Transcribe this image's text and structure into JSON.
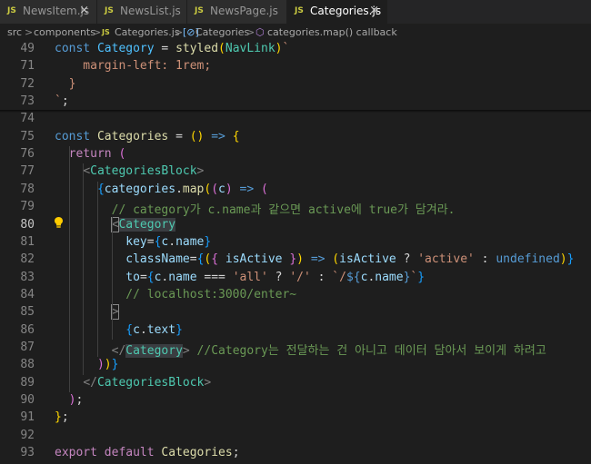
{
  "tabs": [
    {
      "icon": "JS",
      "label": "NewsItem.js",
      "close": "×"
    },
    {
      "icon": "JS",
      "label": "NewsList.js"
    },
    {
      "icon": "JS",
      "label": "NewsPage.js"
    },
    {
      "icon": "JS",
      "label": "Categories.js",
      "close": "×"
    }
  ],
  "breadcrumb": {
    "items": [
      "src",
      "components",
      "Categories.js",
      "Categories",
      "categories.map() callback"
    ],
    "separator": ">",
    "file_icon": "JS",
    "symbol_icon": "[⊘]"
  },
  "colors": {
    "keyword": "#569cd6",
    "control": "#c586c0",
    "function": "#dcdcaa",
    "variable": "#9cdcfe",
    "constant": "#4fc1ff",
    "string": "#ce9178",
    "comment": "#6a9955",
    "tag": "#4ec9b0",
    "punct": "#808080",
    "bracket1": "#ffd700",
    "bracket2": "#da70d6",
    "bracket3": "#179fff"
  },
  "lines": [
    {
      "n": "49",
      "t": [
        [
          "const ",
          "#569cd6"
        ],
        [
          "Category",
          "#4fc1ff"
        ],
        [
          " = ",
          "#d4d4d4"
        ],
        [
          "styled",
          "#dcdcaa"
        ],
        [
          "(",
          "#ffd700"
        ],
        [
          "NavLink",
          "#4ec9b0"
        ],
        [
          ")",
          "#ffd700"
        ],
        [
          "`",
          "#ce9178"
        ]
      ]
    },
    {
      "n": "71",
      "t": [
        [
          "    margin-left: 1rem;",
          "#ce9178"
        ]
      ]
    },
    {
      "n": "72",
      "t": [
        [
          "  }",
          "#ce9178"
        ]
      ]
    },
    {
      "n": "73",
      "t": [
        [
          "`",
          "#ce9178"
        ],
        [
          ";",
          "#d4d4d4"
        ]
      ]
    },
    {
      "n": "74",
      "t": []
    },
    {
      "n": "75",
      "t": [
        [
          "const ",
          "#569cd6"
        ],
        [
          "Categories",
          "#dcdcaa"
        ],
        [
          " = ",
          "#d4d4d4"
        ],
        [
          "()",
          "#ffd700"
        ],
        [
          " ",
          "#d4d4d4"
        ],
        [
          "=>",
          "#569cd6"
        ],
        [
          " ",
          "#d4d4d4"
        ],
        [
          "{",
          "#ffd700"
        ]
      ]
    },
    {
      "n": "76",
      "t": [
        [
          "  ",
          "#d4d4d4"
        ],
        [
          "return",
          "#c586c0"
        ],
        [
          " ",
          "#d4d4d4"
        ],
        [
          "(",
          "#da70d6"
        ]
      ]
    },
    {
      "n": "77",
      "t": [
        [
          "    ",
          "#d4d4d4"
        ],
        [
          "<",
          "#808080"
        ],
        [
          "CategoriesBlock",
          "#4ec9b0"
        ],
        [
          ">",
          "#808080"
        ]
      ]
    },
    {
      "n": "78",
      "t": [
        [
          "      ",
          "#d4d4d4"
        ],
        [
          "{",
          "#179fff"
        ],
        [
          "categories",
          "#9cdcfe"
        ],
        [
          ".",
          "#d4d4d4"
        ],
        [
          "map",
          "#dcdcaa"
        ],
        [
          "(",
          "#ffd700"
        ],
        [
          "(",
          "#da70d6"
        ],
        [
          "c",
          "#9cdcfe"
        ],
        [
          ")",
          "#da70d6"
        ],
        [
          " ",
          "#d4d4d4"
        ],
        [
          "=>",
          "#569cd6"
        ],
        [
          " ",
          "#d4d4d4"
        ],
        [
          "(",
          "#da70d6"
        ]
      ]
    },
    {
      "n": "79",
      "t": [
        [
          "        // category가 c.name과 같으면 active에 true가 담겨라.",
          "#6a9955"
        ]
      ]
    },
    {
      "n": "80",
      "cur": true,
      "t": [
        [
          "        ",
          "#d4d4d4"
        ],
        [
          "<",
          "#808080",
          "bracket-hl"
        ],
        [
          "Category",
          "#4ec9b0",
          "sel-hl"
        ]
      ]
    },
    {
      "n": "81",
      "t": [
        [
          "          ",
          "#d4d4d4"
        ],
        [
          "key",
          "#9cdcfe"
        ],
        [
          "=",
          "#d4d4d4"
        ],
        [
          "{",
          "#179fff"
        ],
        [
          "c",
          "#9cdcfe"
        ],
        [
          ".",
          "#d4d4d4"
        ],
        [
          "name",
          "#9cdcfe"
        ],
        [
          "}",
          "#179fff"
        ]
      ]
    },
    {
      "n": "82",
      "t": [
        [
          "          ",
          "#d4d4d4"
        ],
        [
          "className",
          "#9cdcfe"
        ],
        [
          "=",
          "#d4d4d4"
        ],
        [
          "{",
          "#179fff"
        ],
        [
          "(",
          "#ffd700"
        ],
        [
          "{",
          "#da70d6"
        ],
        [
          " ",
          "#d4d4d4"
        ],
        [
          "isActive",
          "#9cdcfe"
        ],
        [
          " ",
          "#d4d4d4"
        ],
        [
          "}",
          "#da70d6"
        ],
        [
          ")",
          "#ffd700"
        ],
        [
          " ",
          "#d4d4d4"
        ],
        [
          "=>",
          "#569cd6"
        ],
        [
          " ",
          "#d4d4d4"
        ],
        [
          "(",
          "#ffd700"
        ],
        [
          "isActive",
          "#9cdcfe"
        ],
        [
          " ? ",
          "#d4d4d4"
        ],
        [
          "'active'",
          "#ce9178"
        ],
        [
          " : ",
          "#d4d4d4"
        ],
        [
          "undefined",
          "#569cd6"
        ],
        [
          ")",
          "#ffd700"
        ],
        [
          "}",
          "#179fff"
        ]
      ]
    },
    {
      "n": "83",
      "t": [
        [
          "          ",
          "#d4d4d4"
        ],
        [
          "to",
          "#9cdcfe"
        ],
        [
          "=",
          "#d4d4d4"
        ],
        [
          "{",
          "#179fff"
        ],
        [
          "c",
          "#9cdcfe"
        ],
        [
          ".",
          "#d4d4d4"
        ],
        [
          "name",
          "#9cdcfe"
        ],
        [
          " === ",
          "#d4d4d4"
        ],
        [
          "'all'",
          "#ce9178"
        ],
        [
          " ? ",
          "#d4d4d4"
        ],
        [
          "'/'",
          "#ce9178"
        ],
        [
          " : ",
          "#d4d4d4"
        ],
        [
          "`/",
          "#ce9178"
        ],
        [
          "${",
          "#569cd6"
        ],
        [
          "c",
          "#9cdcfe"
        ],
        [
          ".",
          "#d4d4d4"
        ],
        [
          "name",
          "#9cdcfe"
        ],
        [
          "}",
          "#569cd6"
        ],
        [
          "`",
          "#ce9178"
        ],
        [
          "}",
          "#179fff"
        ]
      ]
    },
    {
      "n": "84",
      "t": [
        [
          "          // localhost:3000/enter~",
          "#6a9955"
        ]
      ]
    },
    {
      "n": "85",
      "t": [
        [
          "        ",
          "#d4d4d4"
        ],
        [
          ">",
          "#808080",
          "bracket-hl"
        ]
      ]
    },
    {
      "n": "86",
      "t": [
        [
          "          ",
          "#d4d4d4"
        ],
        [
          "{",
          "#179fff"
        ],
        [
          "c",
          "#9cdcfe"
        ],
        [
          ".",
          "#d4d4d4"
        ],
        [
          "text",
          "#9cdcfe"
        ],
        [
          "}",
          "#179fff"
        ]
      ]
    },
    {
      "n": "87",
      "t": [
        [
          "        ",
          "#d4d4d4"
        ],
        [
          "</",
          "#808080"
        ],
        [
          "Category",
          "#4ec9b0",
          "sel-hl"
        ],
        [
          ">",
          "#808080"
        ],
        [
          " //Category는 전달하는 건 아니고 데이터 담아서 보이게 하려고",
          "#6a9955"
        ]
      ]
    },
    {
      "n": "88",
      "t": [
        [
          "      ",
          "#d4d4d4"
        ],
        [
          ")",
          "#da70d6"
        ],
        [
          ")",
          "#ffd700"
        ],
        [
          "}",
          "#179fff"
        ]
      ]
    },
    {
      "n": "89",
      "t": [
        [
          "    ",
          "#d4d4d4"
        ],
        [
          "</",
          "#808080"
        ],
        [
          "CategoriesBlock",
          "#4ec9b0"
        ],
        [
          ">",
          "#808080"
        ]
      ]
    },
    {
      "n": "90",
      "t": [
        [
          "  ",
          "#d4d4d4"
        ],
        [
          ")",
          "#da70d6"
        ],
        [
          ";",
          "#d4d4d4"
        ]
      ]
    },
    {
      "n": "91",
      "t": [
        [
          "}",
          "#ffd700"
        ],
        [
          ";",
          "#d4d4d4"
        ]
      ]
    },
    {
      "n": "92",
      "t": []
    },
    {
      "n": "93",
      "t": [
        [
          "export",
          "#c586c0"
        ],
        [
          " ",
          "#d4d4d4"
        ],
        [
          "default",
          "#c586c0"
        ],
        [
          " ",
          "#d4d4d4"
        ],
        [
          "Categories",
          "#dcdcaa"
        ],
        [
          ";",
          "#d4d4d4"
        ]
      ]
    }
  ]
}
